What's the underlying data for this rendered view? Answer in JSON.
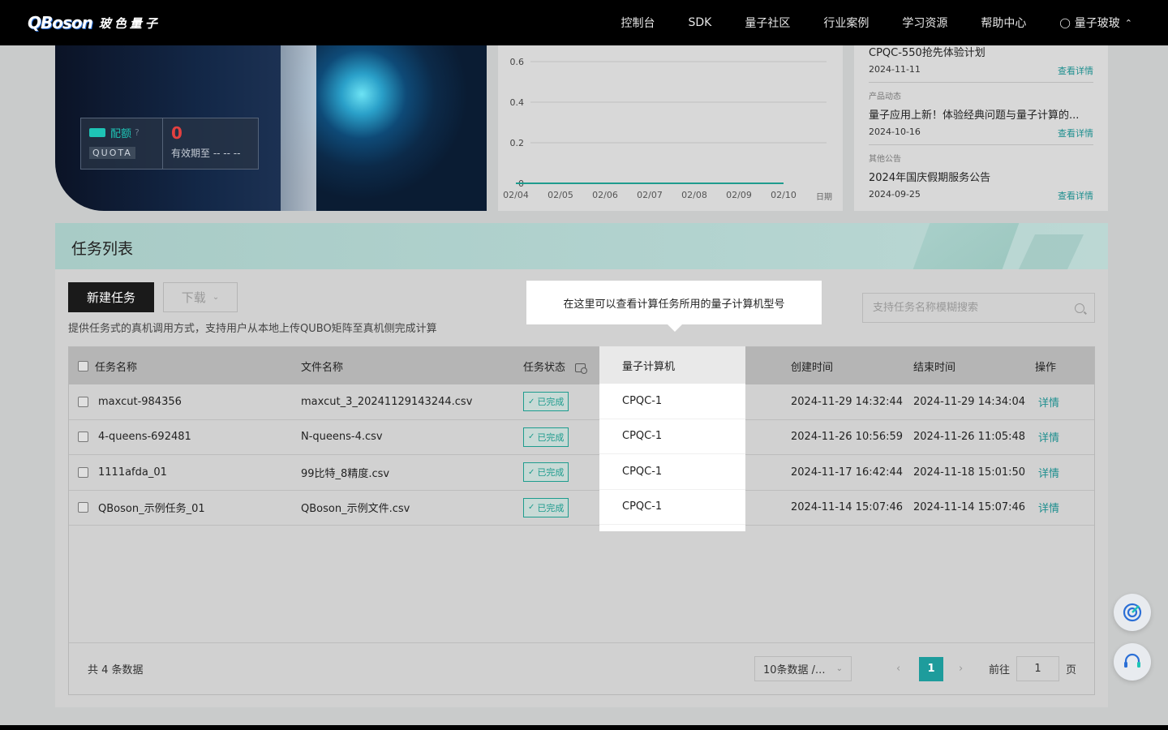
{
  "nav": {
    "logo_mark": "QBoson",
    "logo_cn": "玻色量子",
    "items": [
      "控制台",
      "SDK",
      "量子社区",
      "行业案例",
      "学习资源",
      "帮助中心"
    ],
    "user": "量子玻玻"
  },
  "quota": {
    "label": "配额",
    "en": "QUOTA",
    "value": "0",
    "expiry": "有效期至 -- -- --"
  },
  "chart_data": {
    "type": "line",
    "x": [
      "02/04",
      "02/05",
      "02/06",
      "02/07",
      "02/08",
      "02/09",
      "02/10"
    ],
    "series": [
      {
        "values": [
          0,
          0,
          0,
          0,
          0,
          0,
          0
        ]
      }
    ],
    "xlabel": "日期",
    "ylabel": "",
    "yticks": [
      "0",
      "0.2",
      "0.4",
      "0.6"
    ],
    "ylim": [
      0,
      0.6
    ],
    "grid": true,
    "color": "#1e9c8e"
  },
  "news": {
    "first_title": "CPQC-550抢先体验计划",
    "first_date": "2024-11-11",
    "link": "查看详情",
    "items": [
      {
        "category": "产品动态",
        "title": "量子应用上新！体验经典问题与量子计算的...",
        "date": "2024-10-16"
      },
      {
        "category": "其他公告",
        "title": "2024年国庆假期服务公告",
        "date": "2024-09-25"
      }
    ]
  },
  "tasks": {
    "title": "任务列表",
    "new_btn": "新建任务",
    "download_btn": "下载",
    "desc": "提供任务式的真机调用方式，支持用户从本地上传QUBO矩阵至真机侧完成计算",
    "search_placeholder": "支持任务名称模糊搜索",
    "tooltip": "在这里可以查看计算任务所用的量子计算机型号",
    "columns": [
      "任务名称",
      "文件名称",
      "任务状态",
      "量子计算机",
      "创建时间",
      "结束时间",
      "操作"
    ],
    "rows": [
      {
        "name": "maxcut-984356",
        "file": "maxcut_3_20241129143244.csv",
        "status": "已完成",
        "machine": "CPQC-1",
        "created": "2024-11-29 14:32:44",
        "ended": "2024-11-29 14:34:04",
        "action": "详情"
      },
      {
        "name": "4-queens-692481",
        "file": "N-queens-4.csv",
        "status": "已完成",
        "machine": "CPQC-1",
        "created": "2024-11-26 10:56:59",
        "ended": "2024-11-26 11:05:48",
        "action": "详情"
      },
      {
        "name": "1111afda_01",
        "file": "99比特_8精度.csv",
        "status": "已完成",
        "machine": "CPQC-1",
        "created": "2024-11-17 16:42:44",
        "ended": "2024-11-18 15:01:50",
        "action": "详情"
      },
      {
        "name": "QBoson_示例任务_01",
        "file": "QBoson_示例文件.csv",
        "status": "已完成",
        "machine": "CPQC-1",
        "created": "2024-11-14 15:07:46",
        "ended": "2024-11-14 15:07:46",
        "action": "详情"
      }
    ],
    "total": "共 4 条数据",
    "page_size": "10条数据 /...",
    "current_page": "1",
    "goto_label": "前往",
    "goto_value": "1",
    "page_unit": "页"
  }
}
